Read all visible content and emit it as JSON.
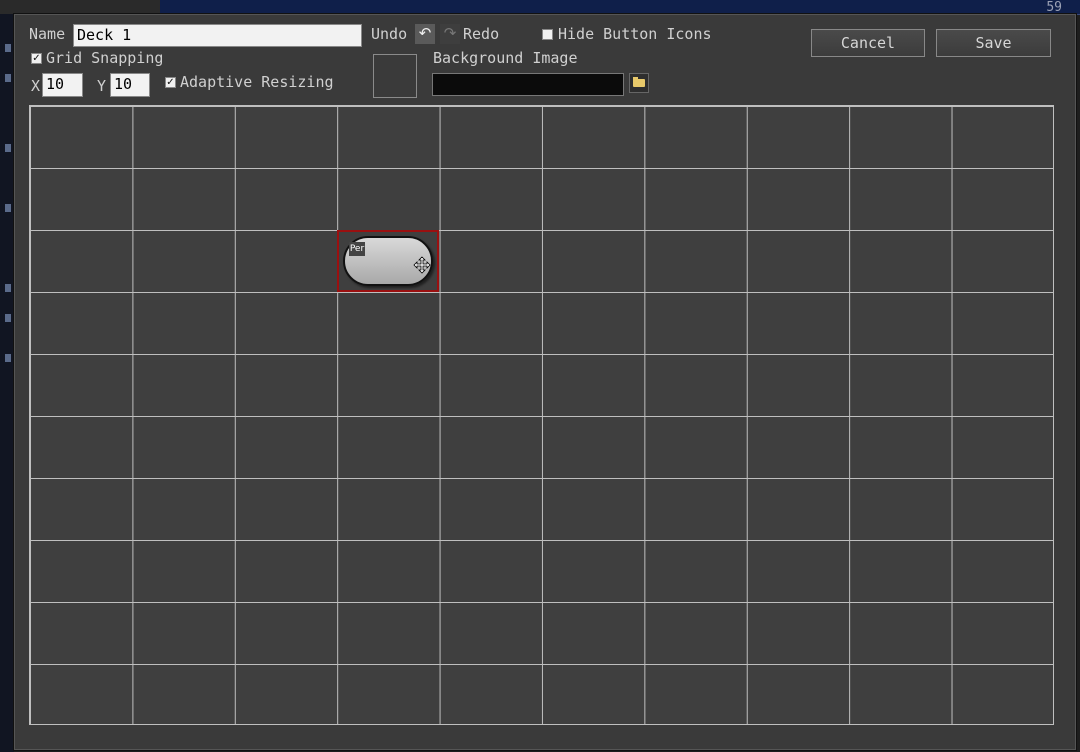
{
  "background": {
    "corner_number": "59"
  },
  "toolbar": {
    "name_label": "Name",
    "name_value": "Deck 1",
    "undo_label": "Undo",
    "redo_label": "Redo",
    "hide_icons_label": "Hide Button Icons",
    "hide_icons_checked": false,
    "grid_snapping_label": "Grid Snapping",
    "grid_snapping_checked": true,
    "x_label": "X",
    "x_value": "10",
    "y_label": "Y",
    "y_value": "10",
    "adaptive_label": "Adaptive Resizing",
    "adaptive_checked": true,
    "bg_image_label": "Background Image",
    "bg_image_value": "",
    "cancel_label": "Cancel",
    "save_label": "Save"
  },
  "grid": {
    "columns": 10,
    "rows": 10
  },
  "selected_button": {
    "badge": "Per",
    "icon": "move-cursor-icon"
  },
  "icons": {
    "undo": "undo-arrow-icon",
    "redo": "redo-arrow-icon",
    "folder": "folder-icon"
  },
  "colors": {
    "dialog": "#3a3a3a",
    "grid_lines": "#bfbfbf",
    "selection": "#9a1010",
    "accent_folder": "#e8c96a"
  }
}
